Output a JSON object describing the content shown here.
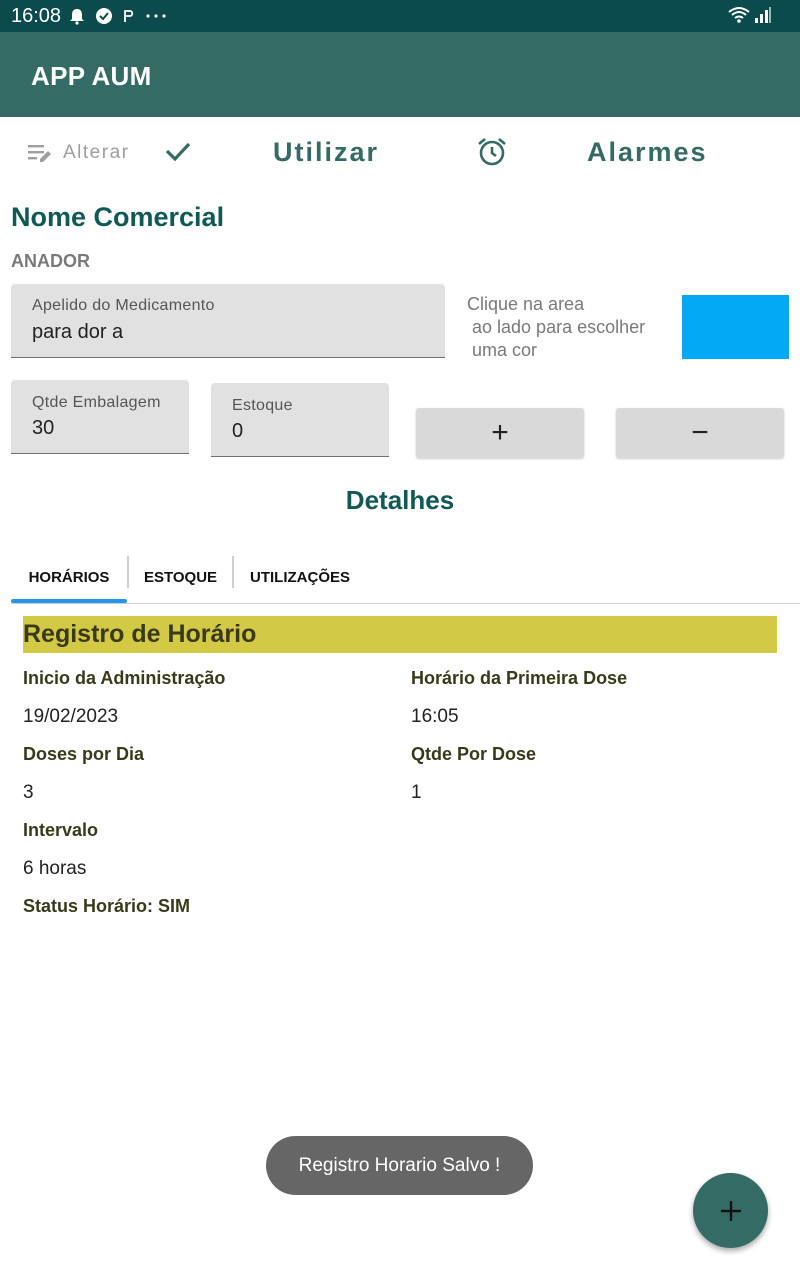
{
  "status_bar": {
    "time": "16:08"
  },
  "app_bar": {
    "title": "APP AUM"
  },
  "toolbar": {
    "alterar_label": "Alterar",
    "utilizar_label": "Utilizar",
    "alarmes_label": "Alarmes"
  },
  "header": {
    "section_title": "Nome Comercial",
    "medication_name": "ANADOR"
  },
  "fields": {
    "apelido_label": "Apelido do Medicamento",
    "apelido_value": "para dor a",
    "qtde_label": "Qtde Embalagem",
    "qtde_value": "30",
    "estoque_label": "Estoque",
    "estoque_value": "0"
  },
  "color_picker": {
    "hint": "Clique na area\n ao lado para escolher\n uma cor",
    "selected_color": "#03a9f4"
  },
  "stock_buttons": {
    "plus": "+",
    "minus": "−"
  },
  "details": {
    "title": "Detalhes",
    "tabs": [
      {
        "label": "HORÁRIOS",
        "active": true
      },
      {
        "label": "ESTOQUE",
        "active": false
      },
      {
        "label": "UTILIZAÇÕES",
        "active": false
      }
    ]
  },
  "registro": {
    "title": "Registro de Horário",
    "inicio_label": "Inicio da Administração",
    "inicio_value": "19/02/2023",
    "primeira_dose_label": "Horário da Primeira Dose",
    "primeira_dose_value": "16:05",
    "doses_dia_label": "Doses por Dia",
    "doses_dia_value": "3",
    "qtde_dose_label": "Qtde Por Dose",
    "qtde_dose_value": "1",
    "intervalo_label": "Intervalo",
    "intervalo_value": "6 horas",
    "status_label": "Status Horário: SIM"
  },
  "toast": {
    "message": "Registro Horario Salvo !"
  },
  "icons": {
    "status": [
      "alarm-icon",
      "check-circle-icon",
      "p-icon",
      "more-dots-icon",
      "wifi-icon",
      "signal-icon"
    ],
    "toolbar": [
      "edit-list-icon",
      "check-icon",
      "alarm-clock-icon"
    ],
    "fab": "plus-icon"
  },
  "colors": {
    "status_bar": "#0b4a4d",
    "app_bar": "#356b65",
    "accent_text": "#0f5a55",
    "header_highlight": "#d2c944",
    "tab_indicator": "#2196f3",
    "fab": "#356b65"
  }
}
